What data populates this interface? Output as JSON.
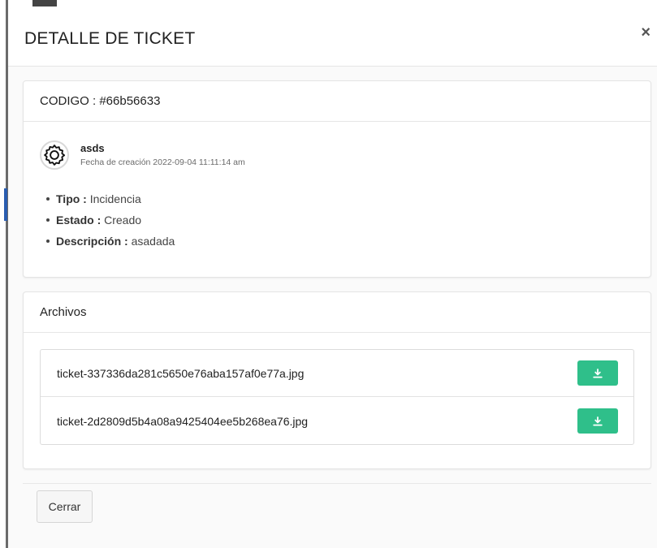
{
  "modal": {
    "title": "DETALLE DE TICKET",
    "close_symbol": "×"
  },
  "ticket": {
    "code_label": "CODIGO : #66b56633",
    "user": {
      "name": "asds",
      "avatar_icon": "gear-icon",
      "created_label": "Fecha de creación 2022-09-04 11:11:14 am"
    },
    "details": [
      {
        "key": "Tipo :",
        "value": " Incidencia"
      },
      {
        "key": "Estado :",
        "value": " Creado"
      },
      {
        "key": "Descripción :",
        "value": " asadada"
      }
    ]
  },
  "files": {
    "heading": "Archivos",
    "items": [
      {
        "name": "ticket-337336da281c5650e76aba157af0e77a.jpg",
        "action_icon": "download-icon"
      },
      {
        "name": "ticket-2d2809d5b4a08a9425404ee5b268ea76.jpg",
        "action_icon": "download-icon"
      }
    ],
    "button_color": "#2fbf8a"
  },
  "footer": {
    "close_label": "Cerrar"
  }
}
